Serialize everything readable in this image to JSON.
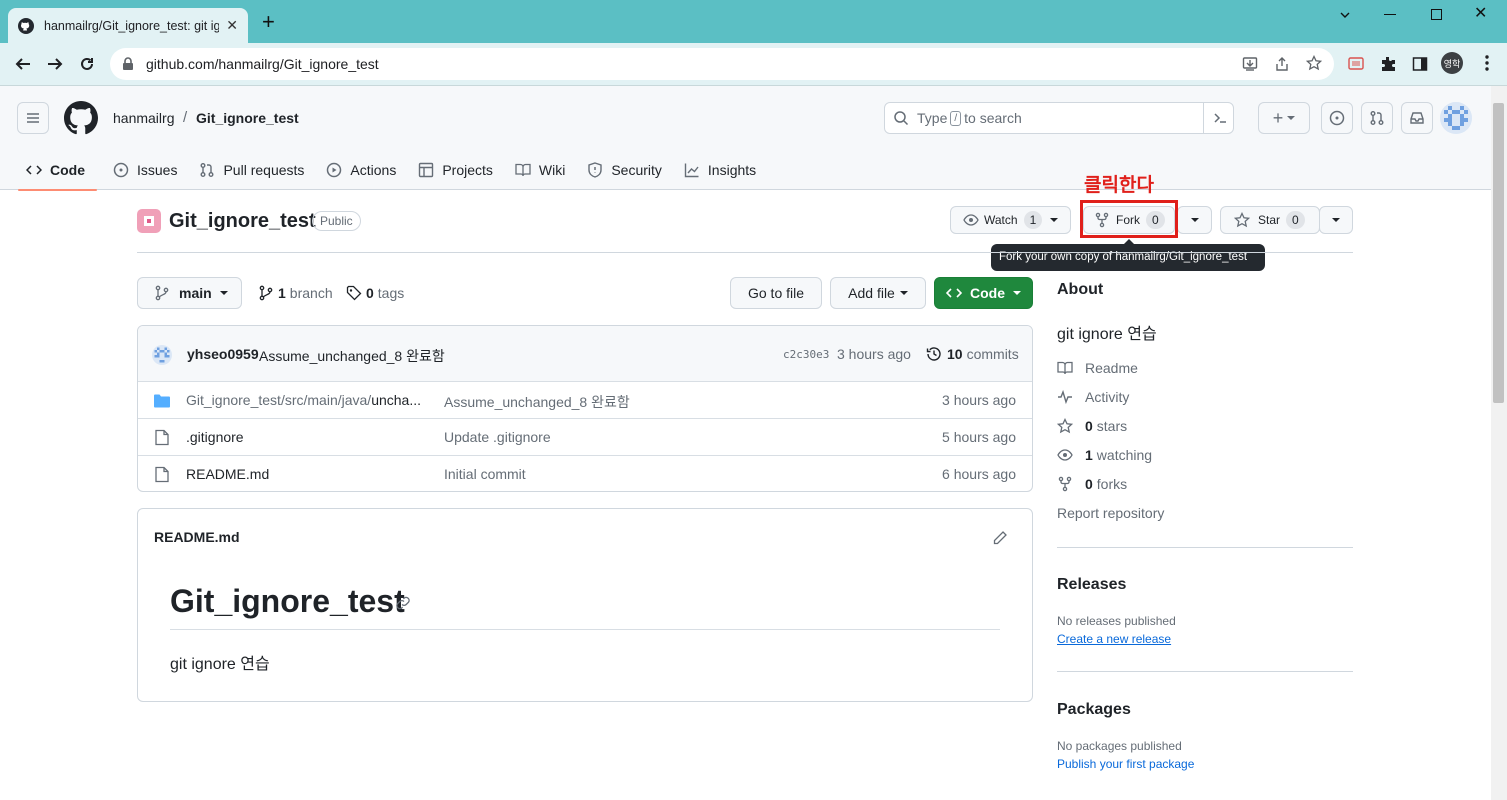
{
  "browser": {
    "tab_title": "hanmailrg/Git_ignore_test: git ig",
    "url": "github.com/hanmailrg/Git_ignore_test",
    "profile_label": "영학"
  },
  "header": {
    "owner": "hanmailrg",
    "separator": "/",
    "repo": "Git_ignore_test",
    "search_prefix": "Type",
    "search_key": "/",
    "search_suffix": "to search"
  },
  "nav": [
    {
      "label": "Code",
      "icon": "code-icon"
    },
    {
      "label": "Issues",
      "icon": "issue-icon"
    },
    {
      "label": "Pull requests",
      "icon": "pull-request-icon"
    },
    {
      "label": "Actions",
      "icon": "play-icon"
    },
    {
      "label": "Projects",
      "icon": "table-icon"
    },
    {
      "label": "Wiki",
      "icon": "book-icon"
    },
    {
      "label": "Security",
      "icon": "shield-icon"
    },
    {
      "label": "Insights",
      "icon": "graph-icon"
    }
  ],
  "repo": {
    "name": "Git_ignore_test",
    "visibility": "Public",
    "watch_label": "Watch",
    "watch_count": "1",
    "fork_label": "Fork",
    "fork_count": "0",
    "star_label": "Star",
    "star_count": "0",
    "annotation": "클릭한다",
    "tooltip": "Fork your own copy of hanmailrg/Git_ignore_test"
  },
  "branch_bar": {
    "branch": "main",
    "branch_count": "1",
    "branch_word": "branch",
    "tag_count": "0",
    "tag_word": "tags",
    "go_to_file": "Go to file",
    "add_file": "Add file",
    "code": "Code"
  },
  "commit": {
    "author": "yhseo0959",
    "message": "Assume_unchanged_8 완료함",
    "sha": "c2c30e3",
    "time": "3 hours ago",
    "commit_count": "10",
    "commit_word": "commits"
  },
  "files": [
    {
      "type": "folder",
      "name_prefix": "Git_ignore_test/src/main/java/",
      "name_bold": "uncha...",
      "message": "Assume_unchanged_8 완료함",
      "time": "3 hours ago"
    },
    {
      "type": "file",
      "name_prefix": ".gitignore",
      "name_bold": "",
      "message": "Update .gitignore",
      "time": "5 hours ago"
    },
    {
      "type": "file",
      "name_prefix": "README.md",
      "name_bold": "",
      "message": "Initial commit",
      "time": "6 hours ago"
    }
  ],
  "readme": {
    "filename": "README.md",
    "heading": "Git_ignore_test",
    "body": "git ignore 연습"
  },
  "about": {
    "title": "About",
    "description": "git ignore 연습",
    "readme": "Readme",
    "activity": "Activity",
    "stars_count": "0",
    "stars_word": "stars",
    "watching_count": "1",
    "watching_word": "watching",
    "forks_count": "0",
    "forks_word": "forks",
    "report": "Report repository"
  },
  "releases": {
    "title": "Releases",
    "none": "No releases published",
    "create": "Create a new release"
  },
  "packages": {
    "title": "Packages",
    "none": "No packages published",
    "publish": "Publish your first package"
  },
  "colors": {
    "chrome_frame": "#5bbfc4",
    "code_button": "#1f883d",
    "annotation_red": "#e0201b",
    "link": "#0969da"
  }
}
